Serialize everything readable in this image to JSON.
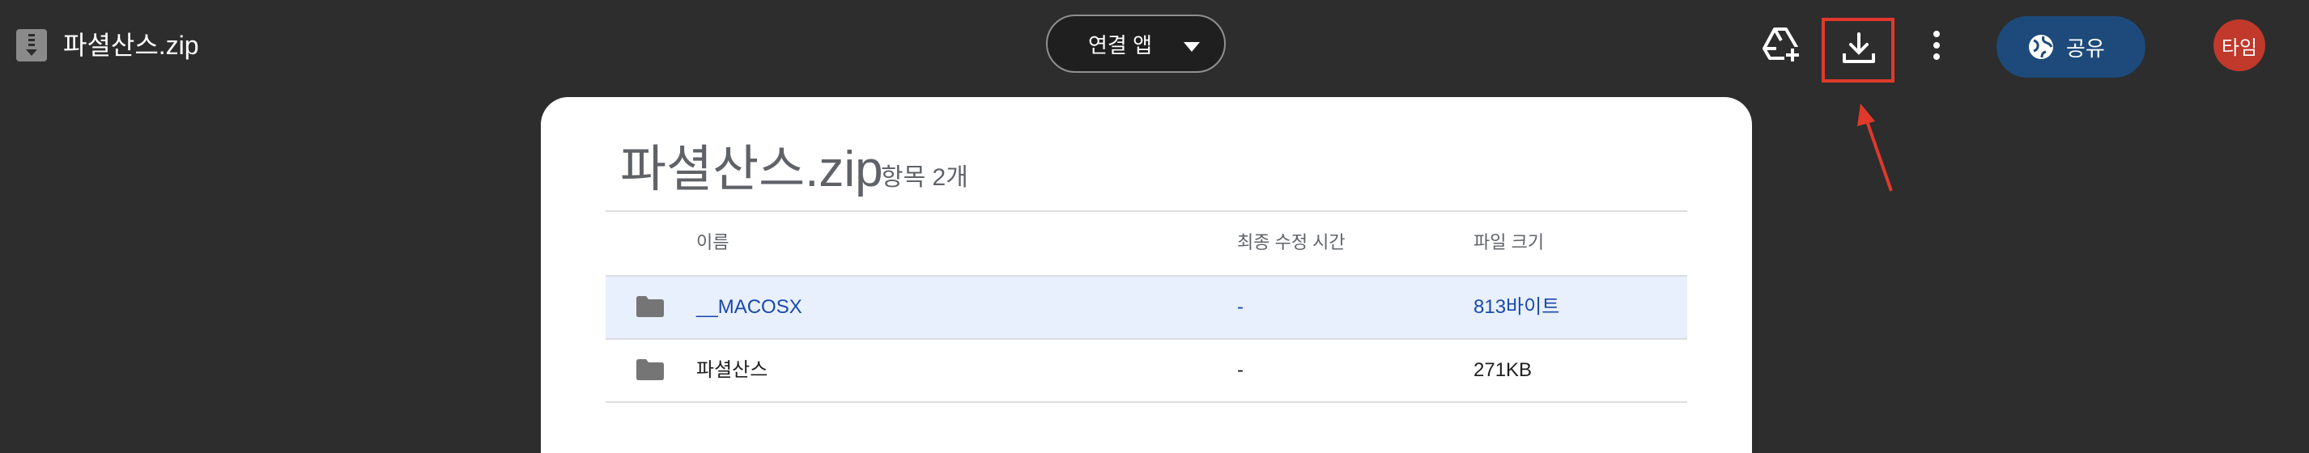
{
  "header": {
    "file_name": "파셜산스.zip",
    "open_with_label": "연결 앱",
    "share_label": "공유",
    "avatar_text": "타임"
  },
  "panel": {
    "title": "파셜산스.zip",
    "item_count": "항목 2개"
  },
  "table": {
    "columns": {
      "name": "이름",
      "modified": "최종 수정 시간",
      "size": "파일 크기"
    },
    "rows": [
      {
        "name": "__MACOSX",
        "modified": "-",
        "size": "813바이트",
        "selected": true
      },
      {
        "name": "파셜산스",
        "modified": "-",
        "size": "271KB",
        "selected": false
      }
    ]
  },
  "colors": {
    "background": "#2d2d2d",
    "share_button": "#1d4a7a",
    "avatar": "#c0392b",
    "highlight": "#e0392b",
    "selected_row": "#e8f0fe"
  }
}
